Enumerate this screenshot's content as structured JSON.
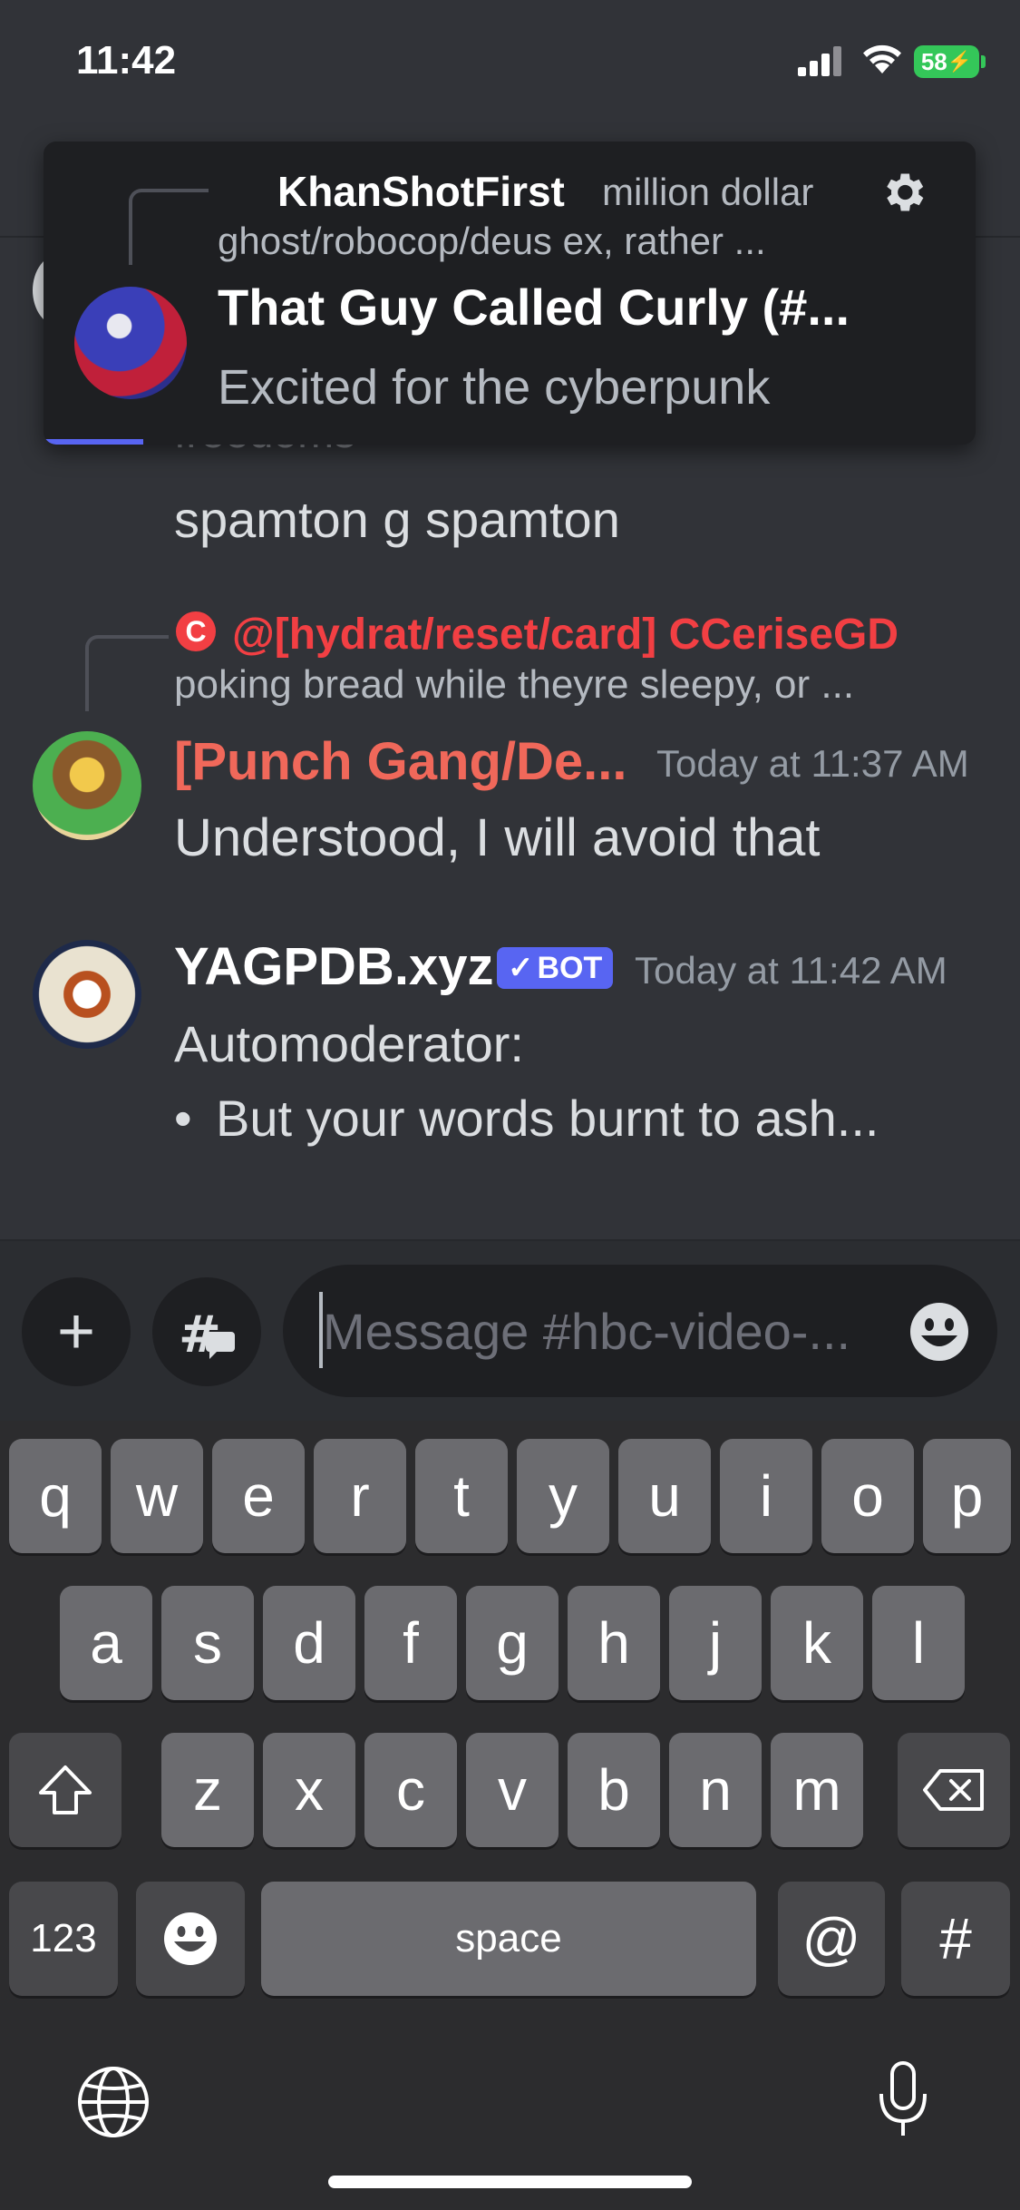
{
  "status_bar": {
    "time": "11:42",
    "battery": "58"
  },
  "notification": {
    "reply_author": "KhanShotFirst",
    "reply_text_1": "million dollar",
    "reply_text_2": "ghost/robocop/deus ex, rather ...",
    "title": "That Guy Called Curly (#...",
    "body": "Excited for the cyberpunk"
  },
  "messages": {
    "partial_text": "freedoms",
    "spamton_text": "spamton g spamton",
    "m2": {
      "reply_icon": "C",
      "reply_author": "@[hydrat/reset/card] CCeriseGD",
      "reply_text": "poking bread while theyre sleepy, or ...",
      "author": "[Punch Gang/De...",
      "time": "Today at 11:37 AM",
      "content": "Understood, I will avoid that"
    },
    "m3": {
      "author": "YAGPDB.xyz",
      "badge": "BOT",
      "time": "Today at 11:42 AM",
      "line1": "Automoderator:",
      "bullet": "•",
      "line2": "But your words burnt to ash..."
    }
  },
  "composer": {
    "plus": "+",
    "placeholder": "Message #hbc-video-..."
  },
  "keyboard": {
    "row1": [
      "q",
      "w",
      "e",
      "r",
      "t",
      "y",
      "u",
      "i",
      "o",
      "p"
    ],
    "row2": [
      "a",
      "s",
      "d",
      "f",
      "g",
      "h",
      "j",
      "k",
      "l"
    ],
    "row3": [
      "z",
      "x",
      "c",
      "v",
      "b",
      "n",
      "m"
    ],
    "numbers": "123",
    "space": "space",
    "at": "@",
    "hash": "#"
  },
  "colors": {
    "accent": "#5865f2",
    "mention_red": "#f23f43",
    "author_red": "#f0685a",
    "background": "#313338"
  }
}
